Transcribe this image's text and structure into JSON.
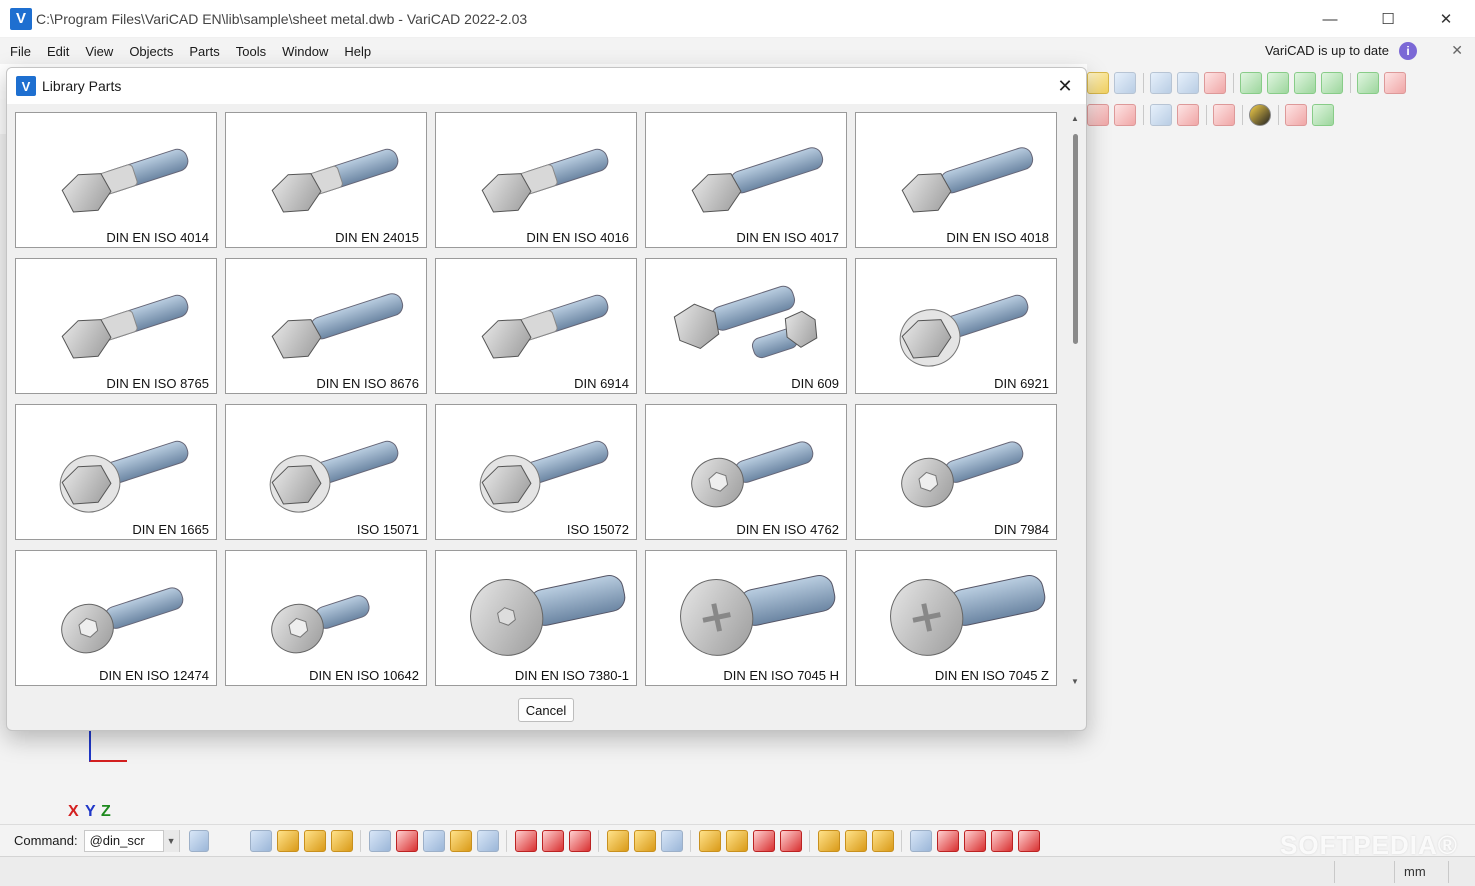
{
  "window": {
    "title": "C:\\Program Files\\VariCAD EN\\lib\\sample\\sheet metal.dwb - VariCAD 2022-2.03",
    "logo_letter": "V",
    "minimize": "—",
    "maximize": "☐",
    "close": "✕"
  },
  "menu": {
    "items": [
      "File",
      "Edit",
      "View",
      "Objects",
      "Parts",
      "Tools",
      "Window",
      "Help"
    ],
    "update_status": "VariCAD is up to date",
    "info_glyph": "i",
    "close_glyph": "✕"
  },
  "dialog": {
    "title": "Library Parts",
    "logo_letter": "V",
    "close_glyph": "✕",
    "cancel_label": "Cancel",
    "parts": [
      {
        "label": "DIN EN ISO 4014",
        "style": "hex-long"
      },
      {
        "label": "DIN EN 24015",
        "style": "hex-reduced"
      },
      {
        "label": "DIN EN ISO 4016",
        "style": "hex-long"
      },
      {
        "label": "DIN EN ISO 4017",
        "style": "hex-full"
      },
      {
        "label": "DIN EN ISO 4018",
        "style": "hex-full"
      },
      {
        "label": "DIN EN ISO 8765",
        "style": "hex-long"
      },
      {
        "label": "DIN EN ISO 8676",
        "style": "hex-full"
      },
      {
        "label": "DIN 6914",
        "style": "hex-long"
      },
      {
        "label": "DIN 609",
        "style": "fit-pair"
      },
      {
        "label": "DIN 6921",
        "style": "flange"
      },
      {
        "label": "DIN EN 1665",
        "style": "flange-hex"
      },
      {
        "label": "ISO 15071",
        "style": "flange-hex"
      },
      {
        "label": "ISO 15072",
        "style": "flange-hex"
      },
      {
        "label": "DIN EN ISO 4762",
        "style": "socket"
      },
      {
        "label": "DIN 7984",
        "style": "socket-low"
      },
      {
        "label": "DIN EN ISO 12474",
        "style": "socket"
      },
      {
        "label": "DIN EN ISO 10642",
        "style": "countersunk"
      },
      {
        "label": "DIN EN ISO 7380-1",
        "style": "button"
      },
      {
        "label": "DIN EN ISO 7045 H",
        "style": "pan-phillips"
      },
      {
        "label": "DIN EN ISO 7045 Z",
        "style": "pan-pozi"
      }
    ]
  },
  "command": {
    "label": "Command:",
    "value": "@din_scr"
  },
  "axes": {
    "x": "X",
    "y": "Y",
    "z": "Z",
    "x_color": "#d42020",
    "y_color": "#2038c8",
    "z_color": "#1e8a1e"
  },
  "status": {
    "unit": "mm"
  },
  "watermark": "SOFTPEDIA®",
  "colors": {
    "accent": "#1e6fd0",
    "thread": "#7f9bb8",
    "head": "#c9c9c9"
  }
}
